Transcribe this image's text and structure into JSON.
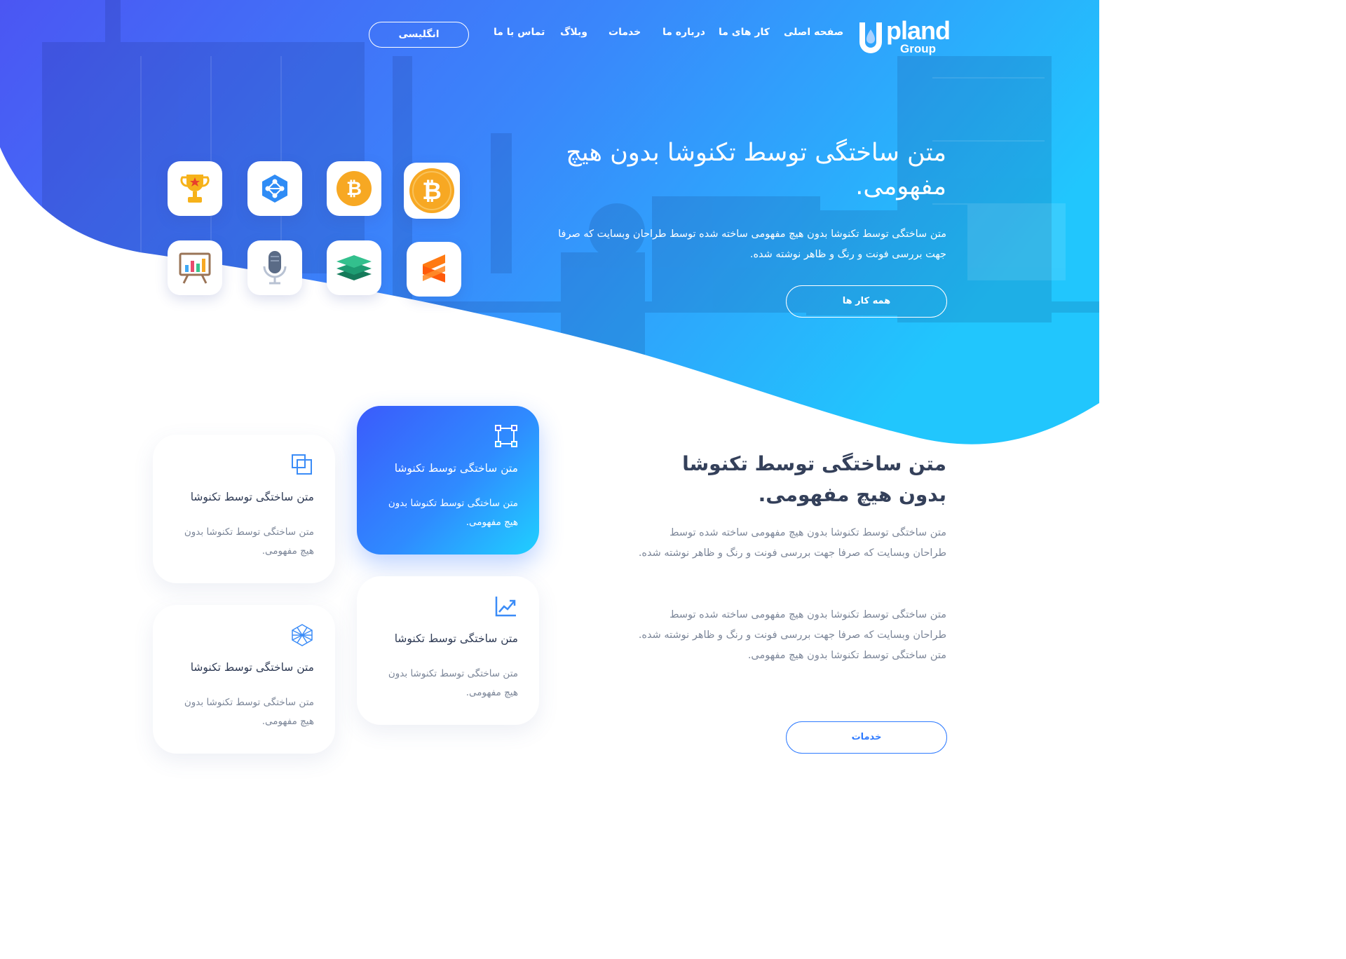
{
  "logo": {
    "word": "pland",
    "sub": "Group"
  },
  "nav": {
    "home": "صفحه اصلی",
    "works": "کار های ما",
    "about": "درباره ما",
    "services": "خدمات",
    "blog": "وبلاگ",
    "contact": "تماس با ما",
    "language": "انگلیسی"
  },
  "hero": {
    "title": "متن ساختگی توسط تکنوشا بدون هیچ مفهومی.",
    "text": "متن ساختگی توسط تکنوشا بدون هیچ مفهومی ساخته شده توسط طراحان وبسایت که صرفا جهت بررسی فونت و رنگ و ظاهر نوشته شده.",
    "button": "همه کار ها",
    "tiles": [
      "trophy-icon",
      "network-icon",
      "bitcoin-icon",
      "bitcoin-icon",
      "presentation-chart-icon",
      "microphone-icon",
      "layers-icon",
      "sublime-icon"
    ]
  },
  "cards": [
    {
      "icon": "frame-select-icon",
      "title": "متن ساختگی توسط تکنوشا",
      "text": "متن ساختگی توسط تکنوشا بدون هیچ مفهومی."
    },
    {
      "icon": "copy-icon",
      "title": "متن ساختگی توسط تکنوشا",
      "text": "متن ساختگی توسط تکنوشا بدون هیچ مفهومی."
    },
    {
      "icon": "trend-chart-icon",
      "title": "متن ساختگی توسط تکنوشا",
      "text": "متن ساختگی توسط تکنوشا بدون هیچ مفهومی."
    },
    {
      "icon": "hexagon-mesh-icon",
      "title": "متن ساختگی توسط تکنوشا",
      "text": "متن ساختگی توسط تکنوشا بدون هیچ مفهومی."
    }
  ],
  "section": {
    "title": "متن ساختگی توسط تکنوشا بدون هیچ مفهومی.",
    "p1": "متن ساختگی توسط تکنوشا بدون هیچ مفهومی ساخته شده توسط طراحان وبسایت که صرفا جهت بررسی فونت و رنگ و ظاهر نوشته شده.",
    "p2": "متن ساختگی توسط تکنوشا بدون هیچ مفهومی ساخته شده توسط طراحان وبسایت که صرفا جهت بررسی فونت و رنگ و ظاهر نوشته شده. متن ساختگی توسط تکنوشا بدون هیچ مفهومی.",
    "button": "خدمات"
  },
  "colors": {
    "accent": "#2f7bff",
    "hero_start": "#4a5cf5",
    "hero_end": "#22c8ff"
  }
}
